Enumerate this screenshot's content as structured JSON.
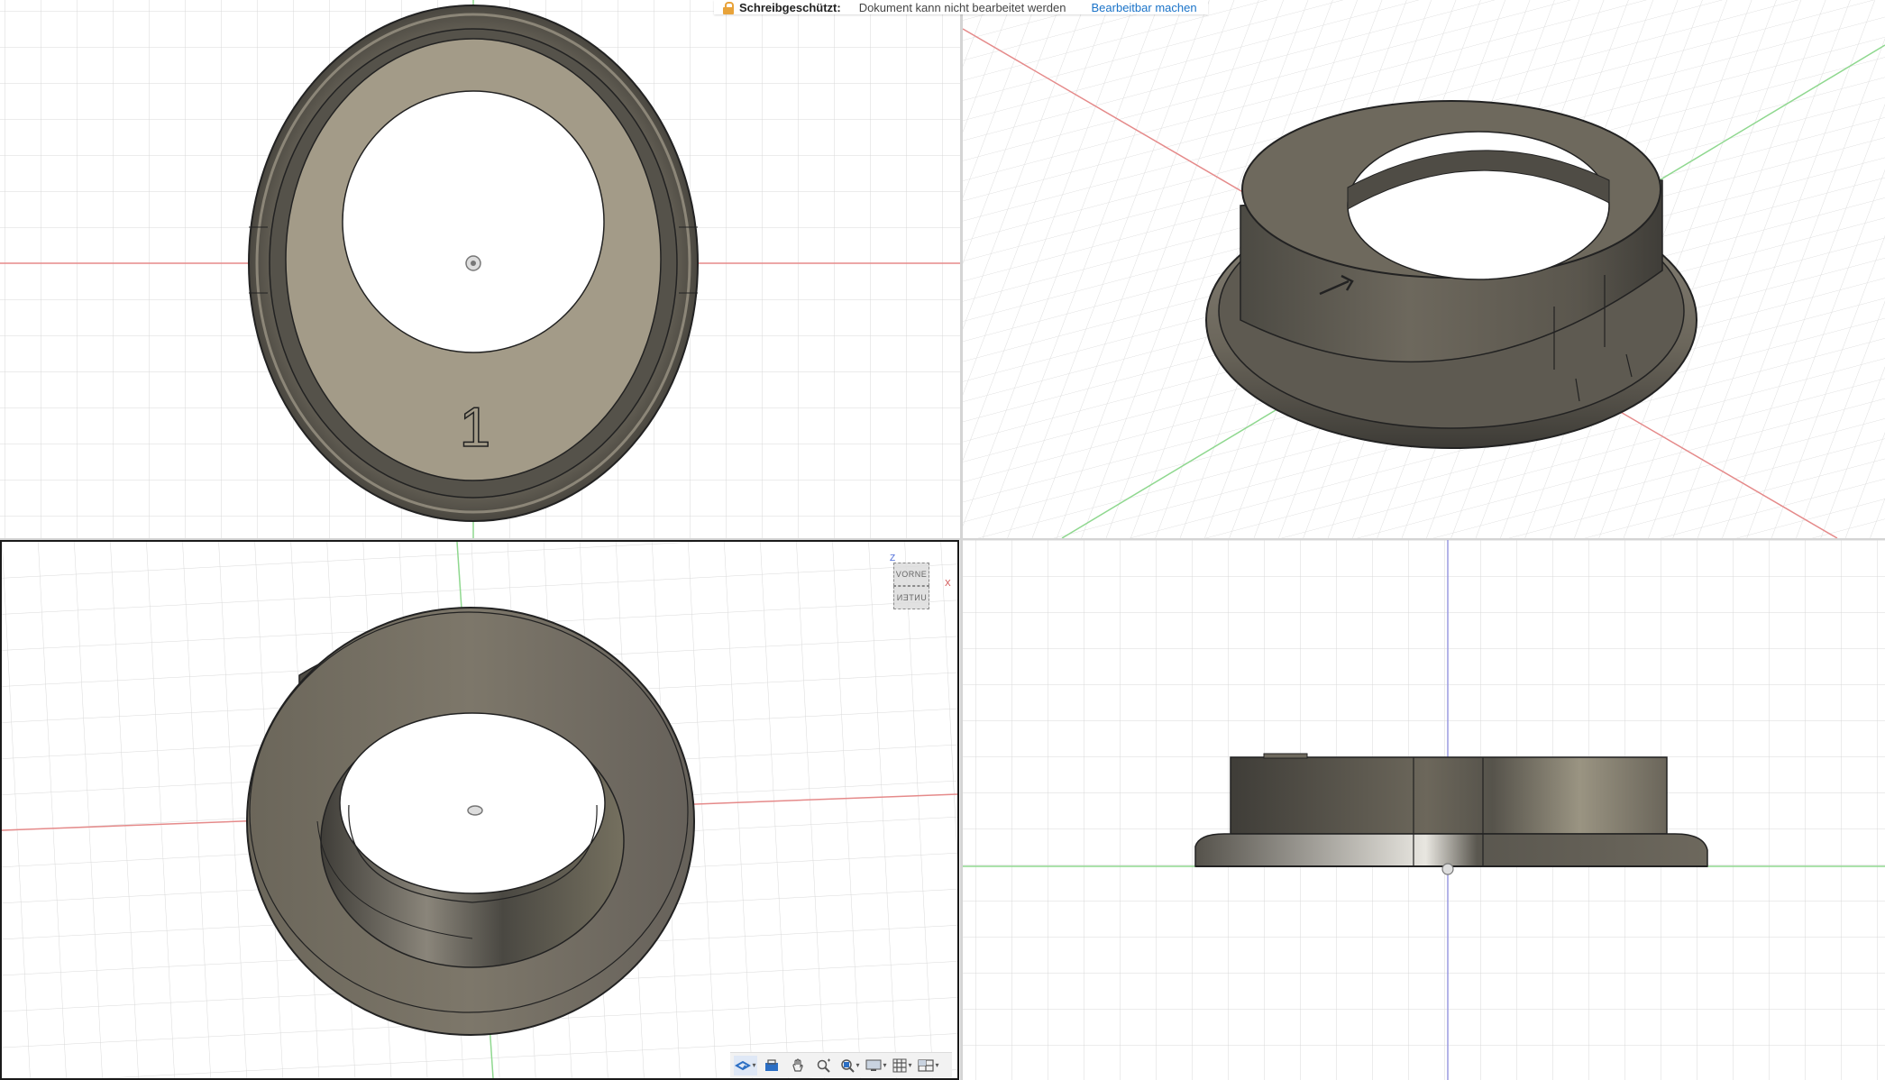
{
  "banner": {
    "label": "Schreibgeschützt:",
    "message": "Dokument kann nicht bearbeitet werden",
    "action": "Bearbeitbar machen",
    "lock_color": "#e8a33a",
    "link_color": "#1a73c8"
  },
  "part": {
    "engraving": "1",
    "body_color": "#7a7466",
    "top_face_color": "#a39b88"
  },
  "viewcube": {
    "top_face": "VORNE",
    "bottom_face": "UNTEN",
    "axis_z": "Z",
    "axis_x": "X"
  },
  "navbar": {
    "icons": [
      "orbit-icon",
      "look-at-icon",
      "pan-icon",
      "zoom-icon",
      "fit-icon",
      "display-settings-icon",
      "grid-icon",
      "viewports-icon"
    ]
  },
  "axis_colors": {
    "x": "#e05a5a",
    "y": "#5ac85a",
    "z": "#6b7fd8"
  }
}
